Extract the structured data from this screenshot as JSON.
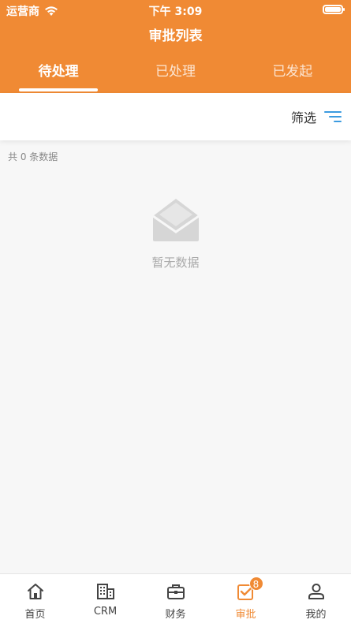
{
  "status_bar": {
    "carrier": "运营商",
    "time": "下午 3:09"
  },
  "header": {
    "title": "审批列表",
    "accent_color": "#f08a34"
  },
  "tabs": [
    {
      "label": "待处理",
      "active": true
    },
    {
      "label": "已处理",
      "active": false
    },
    {
      "label": "已发起",
      "active": false
    }
  ],
  "filter": {
    "label": "筛选"
  },
  "list": {
    "count_text": "共 0 条数据",
    "empty_text": "暂无数据"
  },
  "tabbar": {
    "items": [
      {
        "label": "首页",
        "icon": "home-icon"
      },
      {
        "label": "CRM",
        "icon": "building-icon"
      },
      {
        "label": "财务",
        "icon": "briefcase-icon"
      },
      {
        "label": "审批",
        "icon": "approval-check-icon",
        "active": true,
        "badge": "8"
      },
      {
        "label": "我的",
        "icon": "person-icon"
      }
    ]
  }
}
